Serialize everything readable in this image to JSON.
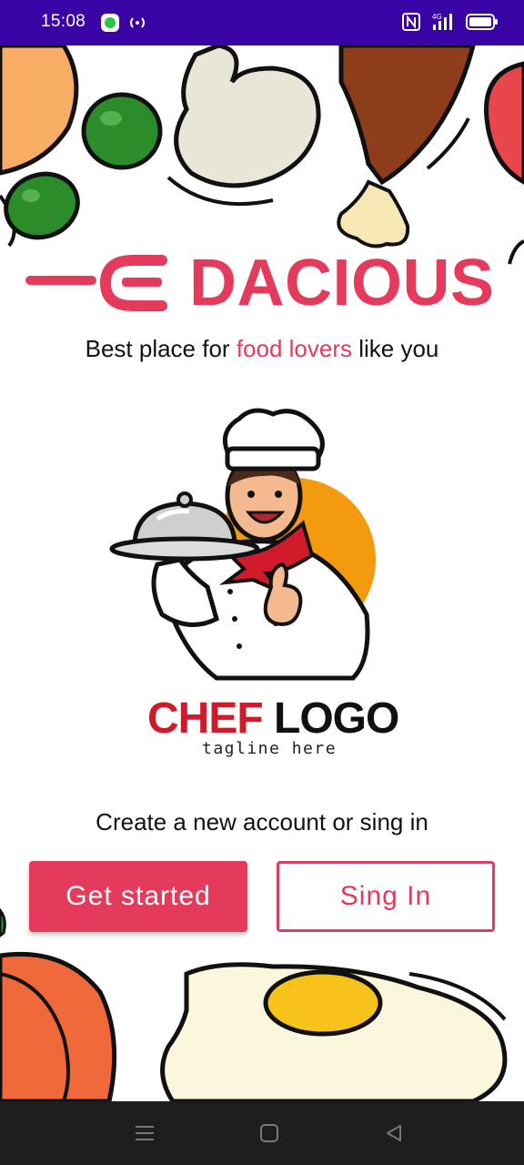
{
  "status_bar": {
    "time": "15:08",
    "icons": [
      "messaging-app-icon",
      "hotspot-icon",
      "nfc-icon",
      "4g-signal-icon",
      "battery-icon"
    ],
    "signal_label": "4G"
  },
  "brand": {
    "name": "DACIOUS",
    "color": "#e43a5c"
  },
  "tagline": {
    "before": "Best place for ",
    "highlight": "food lovers",
    "after": " like you"
  },
  "logo": {
    "word_red": "CHEF",
    "word_black": " LOGO",
    "tagline": "tagline here"
  },
  "prompt": "Create a new account or sing in",
  "buttons": {
    "get_started": "Get started",
    "sign_in": "Sing In"
  },
  "nav_bar": {
    "icons": [
      "menu-icon",
      "home-icon",
      "back-icon"
    ]
  }
}
